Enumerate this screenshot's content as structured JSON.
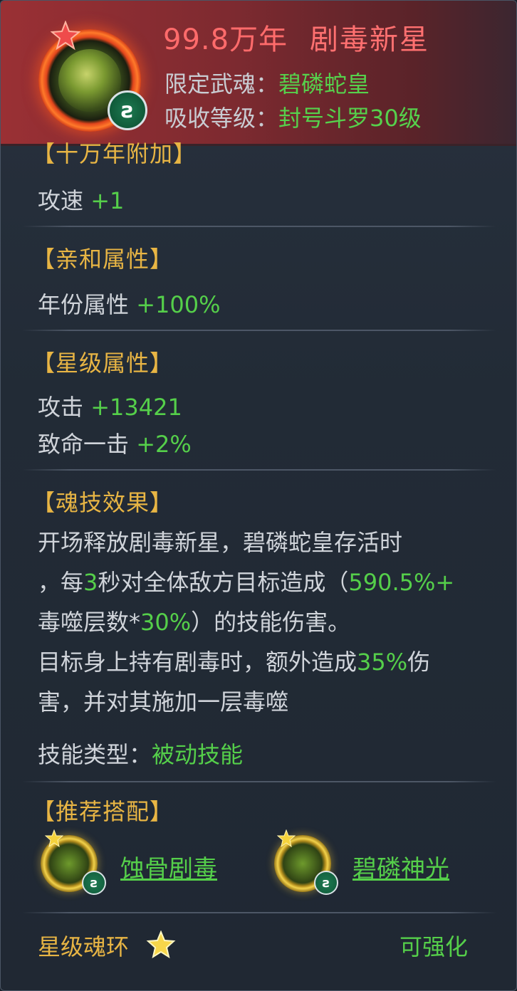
{
  "header": {
    "years": "99.8万年",
    "name": "剧毒新星",
    "limit_label": "限定武魂：",
    "limit_value": "碧磷蛇皇",
    "absorb_label": "吸收等级：",
    "absorb_value": "封号斗罗30级",
    "badge_glyph": "ꙅ"
  },
  "sections": {
    "bonus": {
      "title": "【十万年附加】",
      "line1_label": "攻速 ",
      "line1_value": "+1"
    },
    "affinity": {
      "title": "【亲和属性】",
      "line1_label": "年份属性 ",
      "line1_value": "+100%"
    },
    "star": {
      "title": "【星级属性】",
      "line1_label": "攻击 ",
      "line1_value": "+13421",
      "line2_label": "致命一击 ",
      "line2_value": "+2%"
    },
    "skill": {
      "title": "【魂技效果】",
      "p1": "开场释放剧毒新星，碧磷蛇皇存活时",
      "p2_a": "，每",
      "p2_b": "3",
      "p2_c": "秒对全体敌方目标造成（",
      "p2_d": "590.5%+",
      "p3_a": "毒噬层数*",
      "p3_b": "30%",
      "p3_c": "）的技能伤害。",
      "p4_a": "目标身上持有剧毒时，额外造成",
      "p4_b": "35%",
      "p4_c": "伤",
      "p5": "害，并对其施加一层毒噬",
      "type_label": "技能类型：",
      "type_value": "被动技能"
    },
    "combo": {
      "title": "【推荐搭配】",
      "items": [
        {
          "name": "蚀骨剧毒"
        },
        {
          "name": "碧磷神光"
        }
      ]
    }
  },
  "footer": {
    "left": "星级魂环",
    "right": "可强化"
  },
  "colors": {
    "accent_gold": "#e8b544",
    "value_green": "#55cf4a",
    "title_red": "#ff6b6b"
  }
}
